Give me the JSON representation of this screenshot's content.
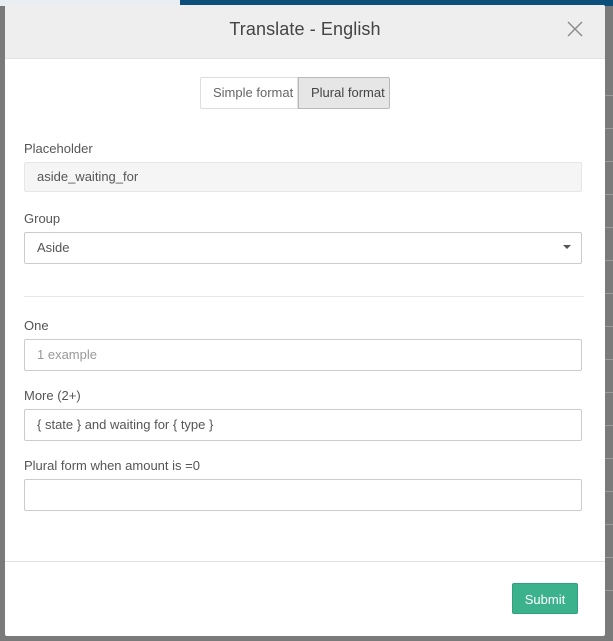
{
  "modal": {
    "title": "Translate - English"
  },
  "format_tabs": {
    "simple_label": "Simple format",
    "plural_label": "Plural format",
    "active": "plural"
  },
  "fields": {
    "placeholder_label": "Placeholder",
    "placeholder_value": "aside_waiting_for",
    "group_label": "Group",
    "group_value": "Aside",
    "one_label": "One",
    "one_placeholder": "1 example",
    "more_label": "More (2+)",
    "more_value": "{ state } and waiting for { type }",
    "zero_label": "Plural form when amount is =0",
    "zero_value": ""
  },
  "footer": {
    "submit_label": "Submit"
  },
  "colors": {
    "submit": "#3bb18c",
    "header_bg": "#eeeeee",
    "backdrop": "#7a7a7a"
  }
}
